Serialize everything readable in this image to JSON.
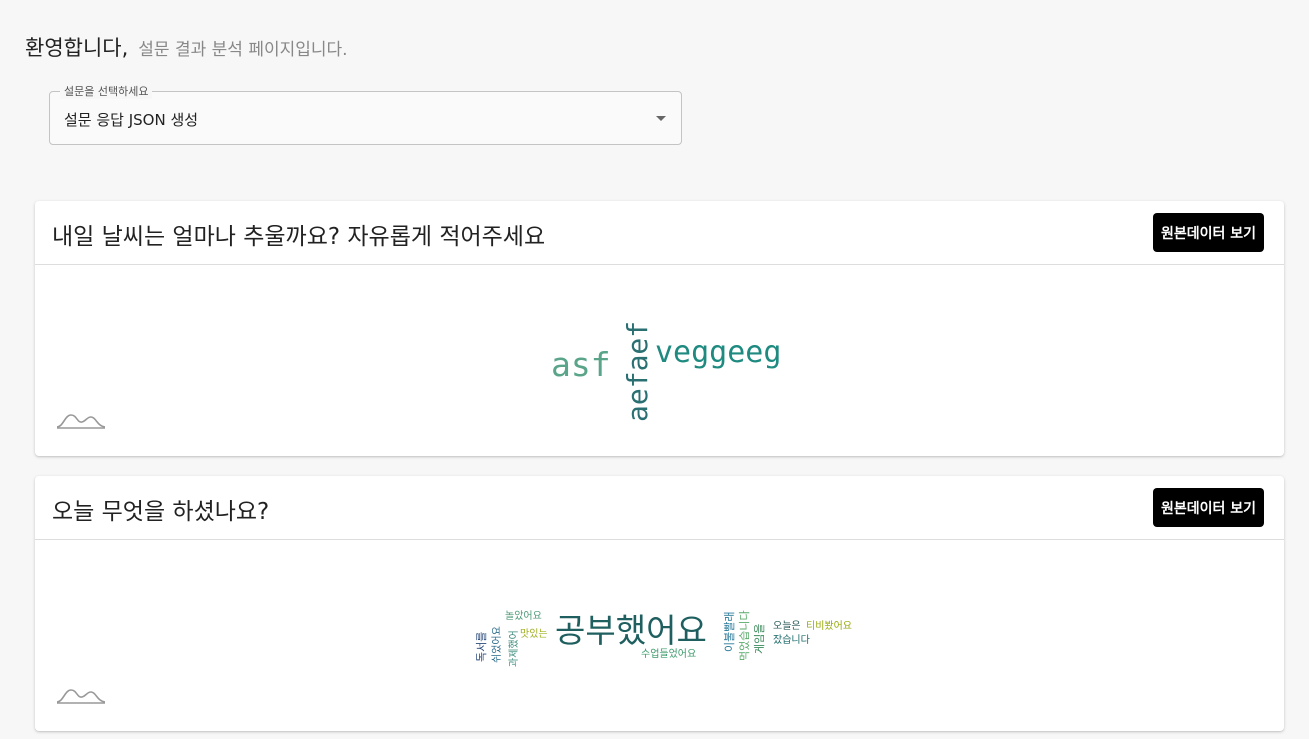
{
  "header": {
    "welcome": "환영합니다,",
    "subtitle": "설문 결과 분석 페이지입니다."
  },
  "survey_select": {
    "label": "설문을 선택하세요",
    "value": "설문 응답 JSON 생성"
  },
  "questions": [
    {
      "title": "내일 날씨는 얼마나 추울까요? 자유롭게 적어주세요",
      "button_label": "원본데이터 보기",
      "words": [
        {
          "text": "asf",
          "color": "#5aa58a"
        },
        {
          "text": "aefaef",
          "color": "#2a6f72"
        },
        {
          "text": "veggeeg",
          "color": "#1e8a80"
        }
      ]
    },
    {
      "title": "오늘 무엇을 하셨나요?",
      "button_label": "원본데이터 보기",
      "words": [
        {
          "text": "공부했어요",
          "color": "#1f5f5f"
        },
        {
          "text": "놀았어요",
          "color": "#4f9a7a"
        },
        {
          "text": "맛있는",
          "color": "#a0b020"
        },
        {
          "text": "과제했어",
          "color": "#3a8a7a"
        },
        {
          "text": "쉬었어요",
          "color": "#2a6a8a"
        },
        {
          "text": "독서를",
          "color": "#2a4a7a"
        },
        {
          "text": "수업들었어요",
          "color": "#3a9a6a"
        },
        {
          "text": "이불빨래",
          "color": "#2a7a9a"
        },
        {
          "text": "먹었습니다",
          "color": "#5aaa6a"
        },
        {
          "text": "게임을",
          "color": "#3a8a5a"
        },
        {
          "text": "오늘은",
          "color": "#2a5a5a"
        },
        {
          "text": "티비봤어요",
          "color": "#9aaa10"
        },
        {
          "text": "잤습니다",
          "color": "#1a6a6a"
        }
      ]
    }
  ]
}
